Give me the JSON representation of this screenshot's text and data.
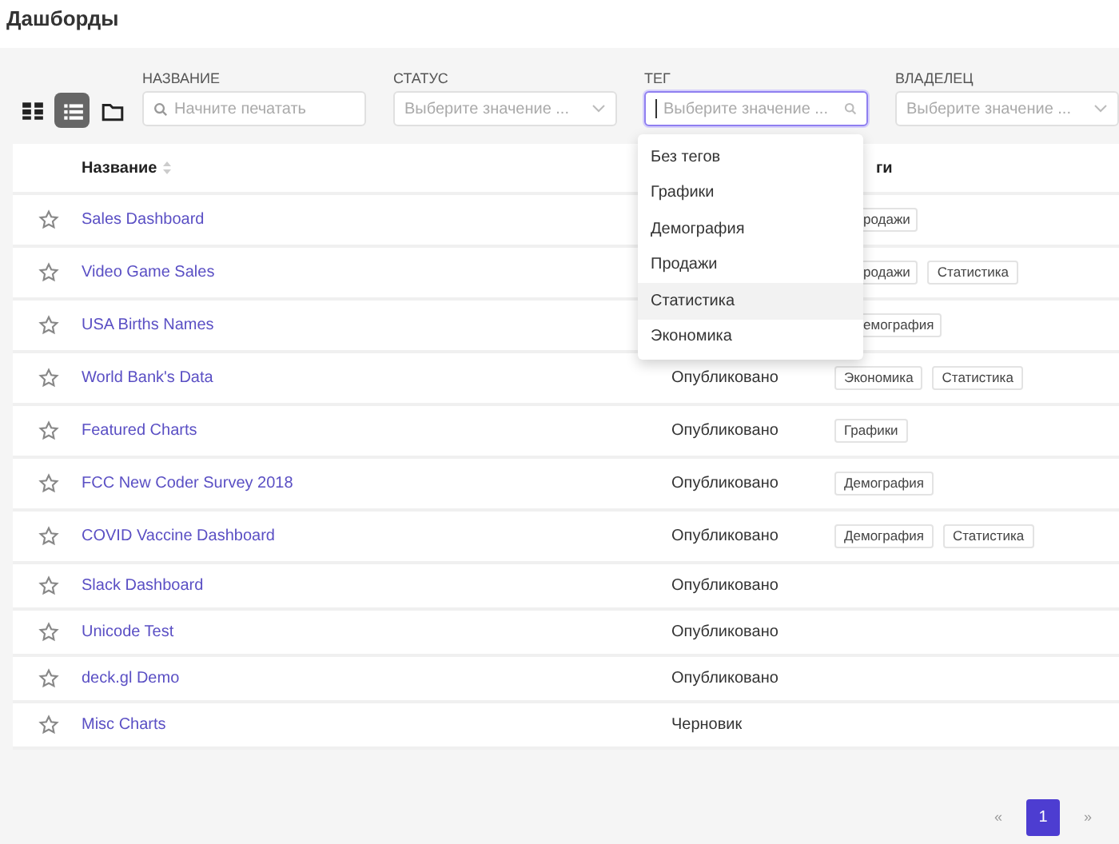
{
  "title": "Дашборды",
  "view_modes": [
    {
      "kind": "grid",
      "selected": false
    },
    {
      "kind": "list",
      "selected": true
    },
    {
      "kind": "folder",
      "selected": false
    }
  ],
  "filters": [
    {
      "label": "НАЗВАНИЕ",
      "kind": "search",
      "placeholder": "Начните печатать",
      "focused": false
    },
    {
      "label": "СТАТУС",
      "kind": "select",
      "placeholder": "Выберите значение ...",
      "focused": false
    },
    {
      "label": "ТЕГ",
      "kind": "select",
      "placeholder": "Выберите значение ...",
      "focused": true
    },
    {
      "label": "ВЛАДЕЛЕЦ",
      "kind": "select",
      "placeholder": "Выберите значение ...",
      "focused": false
    }
  ],
  "tag_dropdown": {
    "options": [
      {
        "label": "Без тегов",
        "selected": false
      },
      {
        "label": "Графики",
        "selected": false
      },
      {
        "label": "Демография",
        "selected": false
      },
      {
        "label": "Продажи",
        "selected": false
      },
      {
        "label": "Статистика",
        "selected": true
      },
      {
        "label": "Экономика",
        "selected": false
      }
    ]
  },
  "table": {
    "columns": [
      "Название",
      "",
      "ги"
    ],
    "rows": [
      {
        "name": "Sales Dashboard",
        "tags": [
          {
            "label": "родажи",
            "cut": true
          }
        ]
      },
      {
        "name": "Video Game Sales",
        "tags": [
          {
            "label": "родажи",
            "cut": true
          },
          {
            "label": "Статистика",
            "cut": false
          }
        ]
      },
      {
        "name": "USA Births Names",
        "tags": [
          {
            "label": "емография",
            "cut": true
          }
        ]
      },
      {
        "name": "World Bank's Data",
        "status": "Опубликовано",
        "tags": [
          {
            "label": "Экономика",
            "cut": false
          },
          {
            "label": "Статистика",
            "cut": false
          }
        ]
      },
      {
        "name": "Featured Charts",
        "status": "Опубликовано",
        "tags": [
          {
            "label": "Графики",
            "cut": false
          }
        ]
      },
      {
        "name": "FCC New Coder Survey 2018",
        "status": "Опубликовано",
        "tags": [
          {
            "label": "Демография",
            "cut": false
          }
        ]
      },
      {
        "name": "COVID Vaccine Dashboard",
        "status": "Опубликовано",
        "tags": [
          {
            "label": "Демография",
            "cut": false
          },
          {
            "label": "Статистика",
            "cut": false
          }
        ]
      },
      {
        "name": "Slack Dashboard",
        "status": "Опубликовано",
        "tags": []
      },
      {
        "name": "Unicode Test",
        "status": "Опубликовано",
        "tags": []
      },
      {
        "name": "deck.gl Demo",
        "status": "Опубликовано",
        "tags": []
      },
      {
        "name": "Misc Charts",
        "status": "Черновик",
        "tags": []
      }
    ]
  },
  "pagination": {
    "prev": "«",
    "pages": [
      {
        "label": "1",
        "selected": true
      }
    ],
    "next": "»"
  }
}
